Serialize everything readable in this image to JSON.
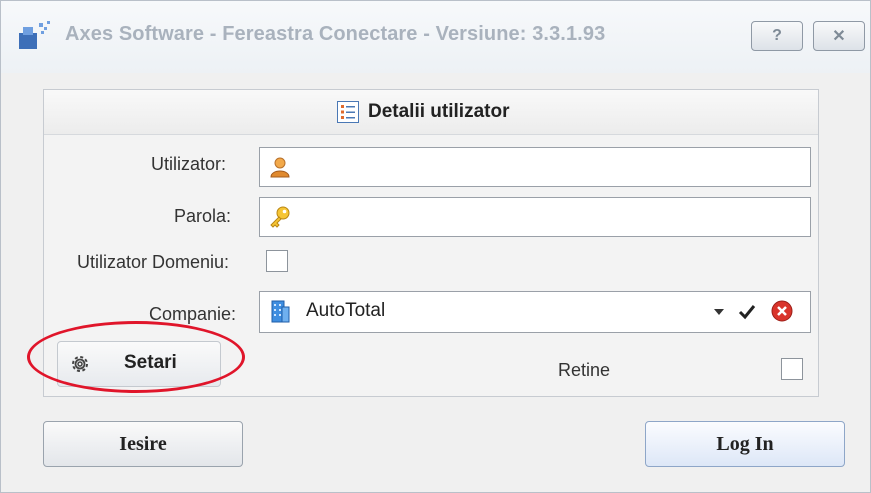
{
  "window": {
    "title": "Axes Software - Fereastra Conectare - Versiune: 3.3.1.93",
    "help_label": "?",
    "close_label": "✕"
  },
  "group": {
    "title": "Detalii utilizator"
  },
  "form": {
    "user_label": "Utilizator:",
    "user_value": "",
    "password_label": "Parola:",
    "password_value": "",
    "domain_user_label": "Utilizator Domeniu:",
    "domain_user_checked": false,
    "company_label": "Companie:",
    "company_value": "AutoTotal",
    "retain_label": "Retine",
    "retain_checked": false
  },
  "buttons": {
    "settings_label": "Setari",
    "exit_label": "Iesire",
    "login_label": "Log In"
  },
  "colors": {
    "highlight_ellipse": "#e0152a",
    "clear_button": "#d9342b",
    "company_icon": "#2f7fd6"
  }
}
